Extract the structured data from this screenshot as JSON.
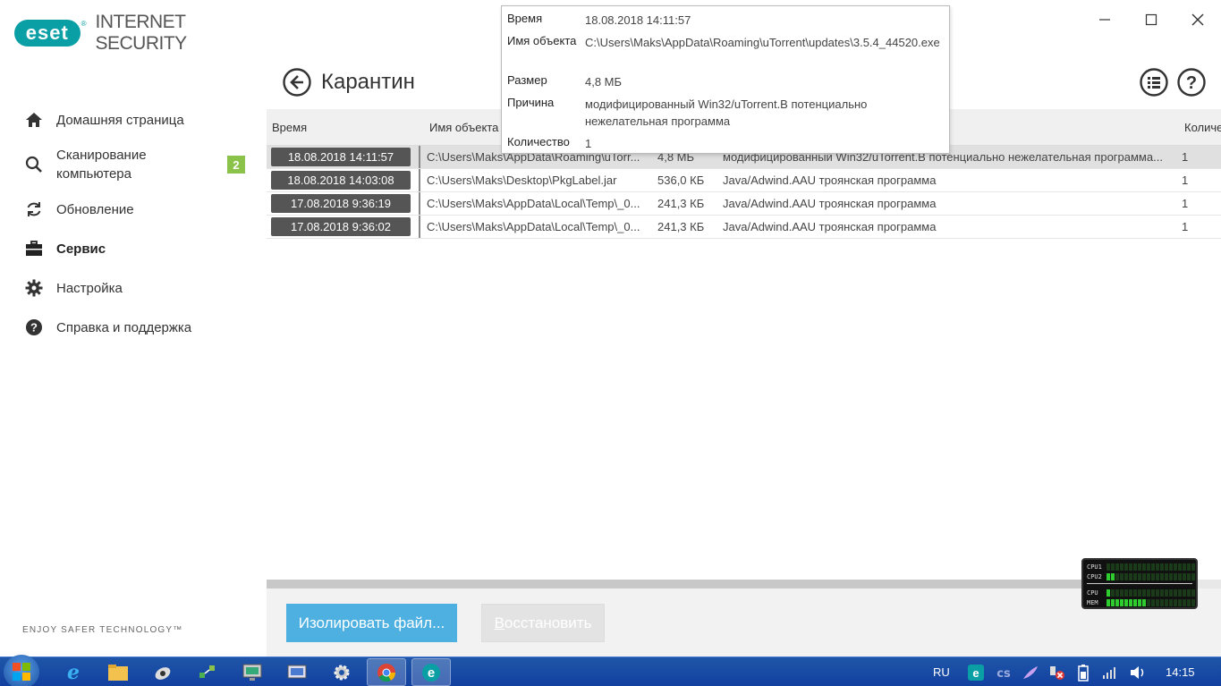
{
  "app": {
    "logo_text": "eset",
    "product_name": "INTERNET SECURITY",
    "tagline": "ENJOY SAFER TECHNOLOGY™"
  },
  "sidebar": {
    "items": [
      {
        "label": "Домашняя страница",
        "icon": "home-icon"
      },
      {
        "label": "Сканирование компьютера",
        "icon": "search-icon",
        "badge": "2"
      },
      {
        "label": "Обновление",
        "icon": "refresh-icon"
      },
      {
        "label": "Сервис",
        "icon": "briefcase-icon",
        "active": true
      },
      {
        "label": "Настройка",
        "icon": "gear-icon"
      },
      {
        "label": "Справка и поддержка",
        "icon": "help-icon"
      }
    ]
  },
  "header": {
    "title": "Карантин"
  },
  "table": {
    "columns": {
      "time": "Время",
      "object": "Имя объекта",
      "count": "Количество"
    },
    "rows": [
      {
        "time": "18.08.2018 14:11:57",
        "object": "C:\\Users\\Maks\\AppData\\Roaming\\uTorr...",
        "size": "4,8 МБ",
        "reason": "модифицированный Win32/uTorrent.B потенциально нежелательная программа...",
        "count": "1"
      },
      {
        "time": "18.08.2018 14:03:08",
        "object": "C:\\Users\\Maks\\Desktop\\PkgLabel.jar",
        "size": "536,0 КБ",
        "reason": "Java/Adwind.AAU троянская программа",
        "count": "1"
      },
      {
        "time": "17.08.2018 9:36:19",
        "object": "C:\\Users\\Maks\\AppData\\Local\\Temp\\_0...",
        "size": "241,3 КБ",
        "reason": "Java/Adwind.AAU троянская программа",
        "count": "1"
      },
      {
        "time": "17.08.2018 9:36:02",
        "object": "C:\\Users\\Maks\\AppData\\Local\\Temp\\_0...",
        "size": "241,3 КБ",
        "reason": "Java/Adwind.AAU троянская программа",
        "count": "1"
      }
    ]
  },
  "tooltip": {
    "time_label": "Время",
    "time_value": "18.08.2018 14:11:57",
    "object_label": "Имя объекта",
    "object_value": "C:\\Users\\Maks\\AppData\\Roaming\\uTorrent\\updates\\3.5.4_44520.exe",
    "size_label": "Размер",
    "size_value": "4,8 МБ",
    "reason_label": "Причина",
    "reason_value": "модифицированный Win32/uTorrent.B потенциально нежелательная программа",
    "count_label": "Количество",
    "count_value": "1"
  },
  "buttons": {
    "isolate": "Изолировать файл...",
    "restore_first": "В",
    "restore_rest": "осстановить"
  },
  "widget": {
    "cpu1": "CPU1",
    "cpu2": "CPU2",
    "cpu": "CPU",
    "mem": "MEM",
    "cpu1_level": 0.0,
    "cpu2_level": 0.1,
    "cpu_level": 0.05,
    "mem_level": 0.45
  },
  "taskbar": {
    "lang": "RU",
    "clock": "14:15"
  },
  "colors": {
    "eset_teal": "#0a9fa5",
    "primary_button": "#4db0e0",
    "badge_green": "#8bc34a"
  }
}
